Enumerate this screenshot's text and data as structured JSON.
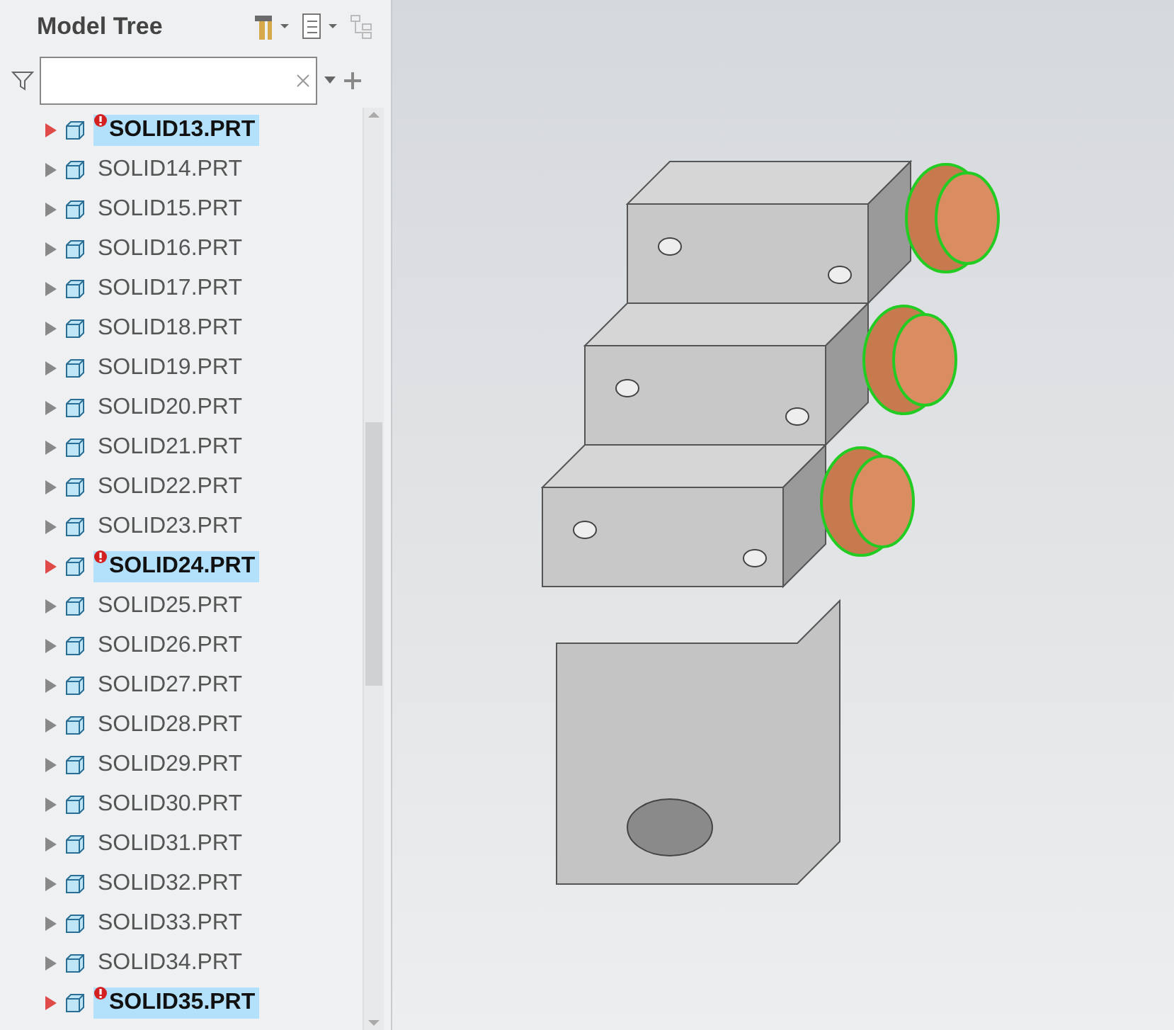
{
  "panel": {
    "title": "Model Tree"
  },
  "items": [
    {
      "label": "SOLID13.PRT",
      "selected": true,
      "warning": true
    },
    {
      "label": "SOLID14.PRT",
      "selected": false,
      "warning": false
    },
    {
      "label": "SOLID15.PRT",
      "selected": false,
      "warning": false
    },
    {
      "label": "SOLID16.PRT",
      "selected": false,
      "warning": false
    },
    {
      "label": "SOLID17.PRT",
      "selected": false,
      "warning": false
    },
    {
      "label": "SOLID18.PRT",
      "selected": false,
      "warning": false
    },
    {
      "label": "SOLID19.PRT",
      "selected": false,
      "warning": false
    },
    {
      "label": "SOLID20.PRT",
      "selected": false,
      "warning": false
    },
    {
      "label": "SOLID21.PRT",
      "selected": false,
      "warning": false
    },
    {
      "label": "SOLID22.PRT",
      "selected": false,
      "warning": false
    },
    {
      "label": "SOLID23.PRT",
      "selected": false,
      "warning": false
    },
    {
      "label": "SOLID24.PRT",
      "selected": true,
      "warning": true
    },
    {
      "label": "SOLID25.PRT",
      "selected": false,
      "warning": false
    },
    {
      "label": "SOLID26.PRT",
      "selected": false,
      "warning": false
    },
    {
      "label": "SOLID27.PRT",
      "selected": false,
      "warning": false
    },
    {
      "label": "SOLID28.PRT",
      "selected": false,
      "warning": false
    },
    {
      "label": "SOLID29.PRT",
      "selected": false,
      "warning": false
    },
    {
      "label": "SOLID30.PRT",
      "selected": false,
      "warning": false
    },
    {
      "label": "SOLID31.PRT",
      "selected": false,
      "warning": false
    },
    {
      "label": "SOLID32.PRT",
      "selected": false,
      "warning": false
    },
    {
      "label": "SOLID33.PRT",
      "selected": false,
      "warning": false
    },
    {
      "label": "SOLID34.PRT",
      "selected": false,
      "warning": false
    },
    {
      "label": "SOLID35.PRT",
      "selected": true,
      "warning": true
    }
  ]
}
